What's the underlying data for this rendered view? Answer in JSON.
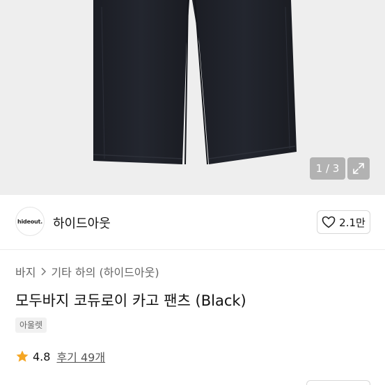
{
  "gallery": {
    "counter": "1 / 3",
    "background": "#eeeeee",
    "expand_icon": "expand-icon"
  },
  "brand": {
    "logo_text": "hideout.",
    "name": "하이드아웃",
    "like_count": "2.1만",
    "like_icon": "heart-icon"
  },
  "breadcrumb": {
    "category": "바지",
    "subcategory": "기타 하의 (하이드아웃)",
    "separator_icon": "chevron-right-icon"
  },
  "product": {
    "title": "모두바지 코듀로이 카고 팬츠 (Black)",
    "tag": "아울렛"
  },
  "rating": {
    "score": "4.8",
    "reviews_label": "후기 49개",
    "star_color": "#f5a623"
  }
}
